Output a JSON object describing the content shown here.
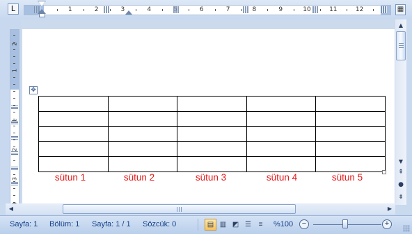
{
  "ruler": {
    "tab_selector": "L",
    "numbers": [
      "1",
      "2",
      "3",
      "4",
      "5",
      "6",
      "7",
      "8",
      "9",
      "10",
      "11",
      "12"
    ],
    "view_ruler_icon": "view-ruler-icon"
  },
  "vertical_ruler": {
    "numbers": [
      "2",
      "1",
      "1",
      "2",
      "3",
      "4"
    ]
  },
  "table": {
    "rows": 5,
    "columns": 5,
    "column_labels": [
      "sütun 1",
      "sütun 2",
      "sütun 3",
      "sütun 4",
      "sütun 5"
    ],
    "label_color": "#e8191a"
  },
  "status": {
    "page": "Sayfa: 1",
    "section": "Bölüm: 1",
    "page_count": "Sayfa: 1 / 1",
    "words": "Sözcük: 0",
    "zoom": "%100",
    "zoom_out": "−",
    "zoom_in": "+"
  },
  "views": [
    "print-layout",
    "full-screen-reading",
    "web-layout",
    "outline",
    "draft"
  ],
  "colors": {
    "accent": "#15428b",
    "frame": "#c7d8ef"
  }
}
